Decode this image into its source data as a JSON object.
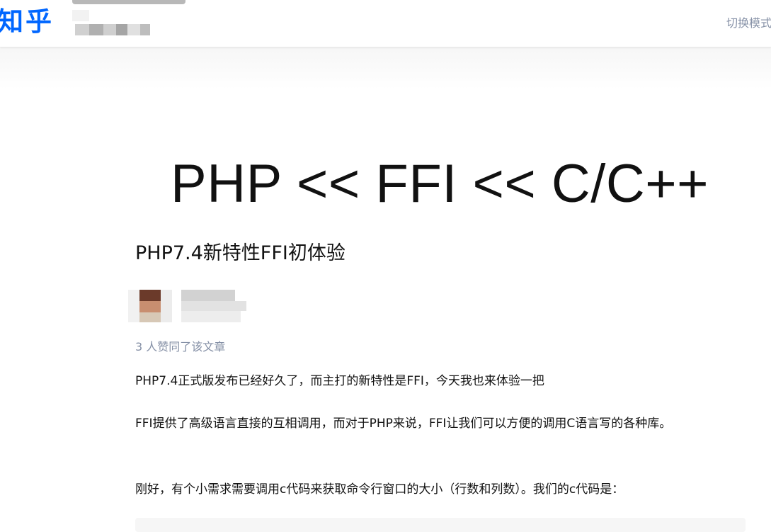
{
  "header": {
    "logo": "知乎",
    "mode_toggle": "切换模式"
  },
  "hero": {
    "text": "PHP << FFI << C/C++"
  },
  "article": {
    "title": "PHP7.4新特性FFI初体验",
    "vote_count": "3 人赞同了该文章",
    "paragraphs": [
      "PHP7.4正式版发布已经好久了，而主打的新特性是FFI，今天我也来体验一把",
      "FFI提供了高级语言直接的互相调用，而对于PHP来说，FFI让我们可以方便的调用C语言写的各种库。",
      "刚好，有个小需求需要调用c代码来获取命令行窗口的大小（行数和列数）。我们的c代码是："
    ]
  },
  "colors": {
    "brand": "#0066ff",
    "muted_text": "#8590a6",
    "body_text": "#121212"
  }
}
